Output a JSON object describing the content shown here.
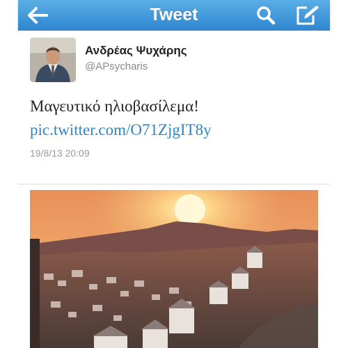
{
  "nav": {
    "title": "Tweet",
    "back_icon": "back-arrow-icon",
    "search_icon": "search-icon",
    "compose_icon": "compose-icon"
  },
  "tweet": {
    "author_name": "Ανδρέας Ψυχάρης",
    "author_handle": "@APsycharis",
    "text": "Μαγευτικό ηλιοβασίλεμα!",
    "link": "pic.twitter.com/O71ZjgIT8y",
    "timestamp": "19/8/13 20:09"
  },
  "colors": {
    "nav_bar": "#3f97da",
    "link": "#2e86c1",
    "muted_text": "#8a8a8a"
  }
}
